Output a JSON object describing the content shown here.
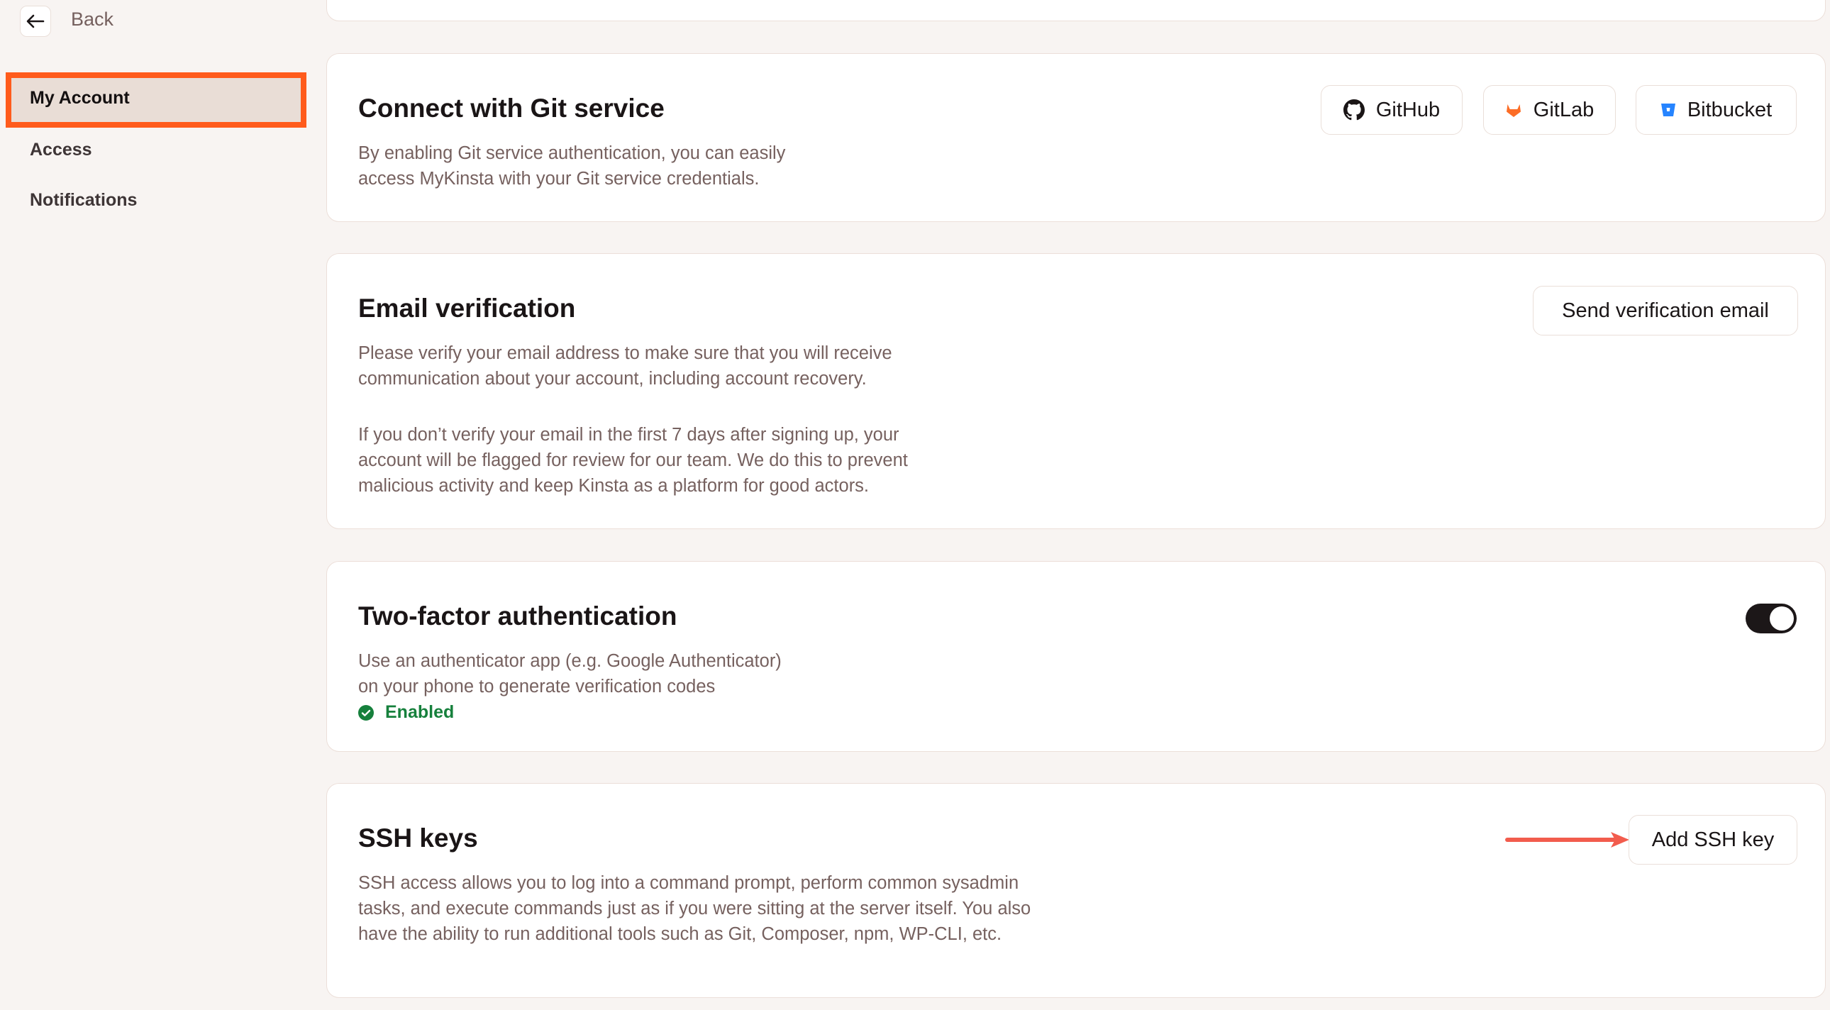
{
  "sidebar": {
    "back_label": "Back",
    "items": [
      {
        "label": "My Account",
        "active": true
      },
      {
        "label": "Access"
      },
      {
        "label": "Notifications"
      }
    ]
  },
  "colors": {
    "highlight": "#ff5b1c",
    "success": "#16803c",
    "gitlab": "#fc6d26",
    "bitbucket": "#2684ff",
    "annotation_arrow": "#f25c4d"
  },
  "git": {
    "title": "Connect with Git service",
    "desc_lines": [
      "By enabling Git service authentication, you can easily",
      "access MyKinsta with your Git service credentials."
    ],
    "buttons": [
      {
        "label": "GitHub",
        "icon": "github-icon"
      },
      {
        "label": "GitLab",
        "icon": "gitlab-icon"
      },
      {
        "label": "Bitbucket",
        "icon": "bitbucket-icon"
      }
    ]
  },
  "email": {
    "title": "Email verification",
    "para1": [
      "Please verify your email address to make sure that you will receive",
      "communication about your account, including account recovery."
    ],
    "para2": [
      "If you don’t verify your email in the first 7 days after signing up, your",
      "account will be flagged for review for our team. We do this to prevent",
      "malicious activity and keep Kinsta as a platform for good actors."
    ],
    "button": "Send verification email"
  },
  "twofa": {
    "title": "Two-factor authentication",
    "desc_lines": [
      "Use an authenticator app (e.g. Google Authenticator)",
      "on your phone to generate verification codes"
    ],
    "status": "Enabled",
    "toggle_on": true
  },
  "ssh": {
    "title": "SSH keys",
    "desc_lines": [
      "SSH access allows you to log into a command prompt, perform common sysadmin",
      "tasks, and execute commands just as if you were sitting at the server itself. You also",
      "have the ability to run additional tools such as Git, Composer, npm, WP-CLI, etc."
    ],
    "button": "Add SSH key"
  }
}
